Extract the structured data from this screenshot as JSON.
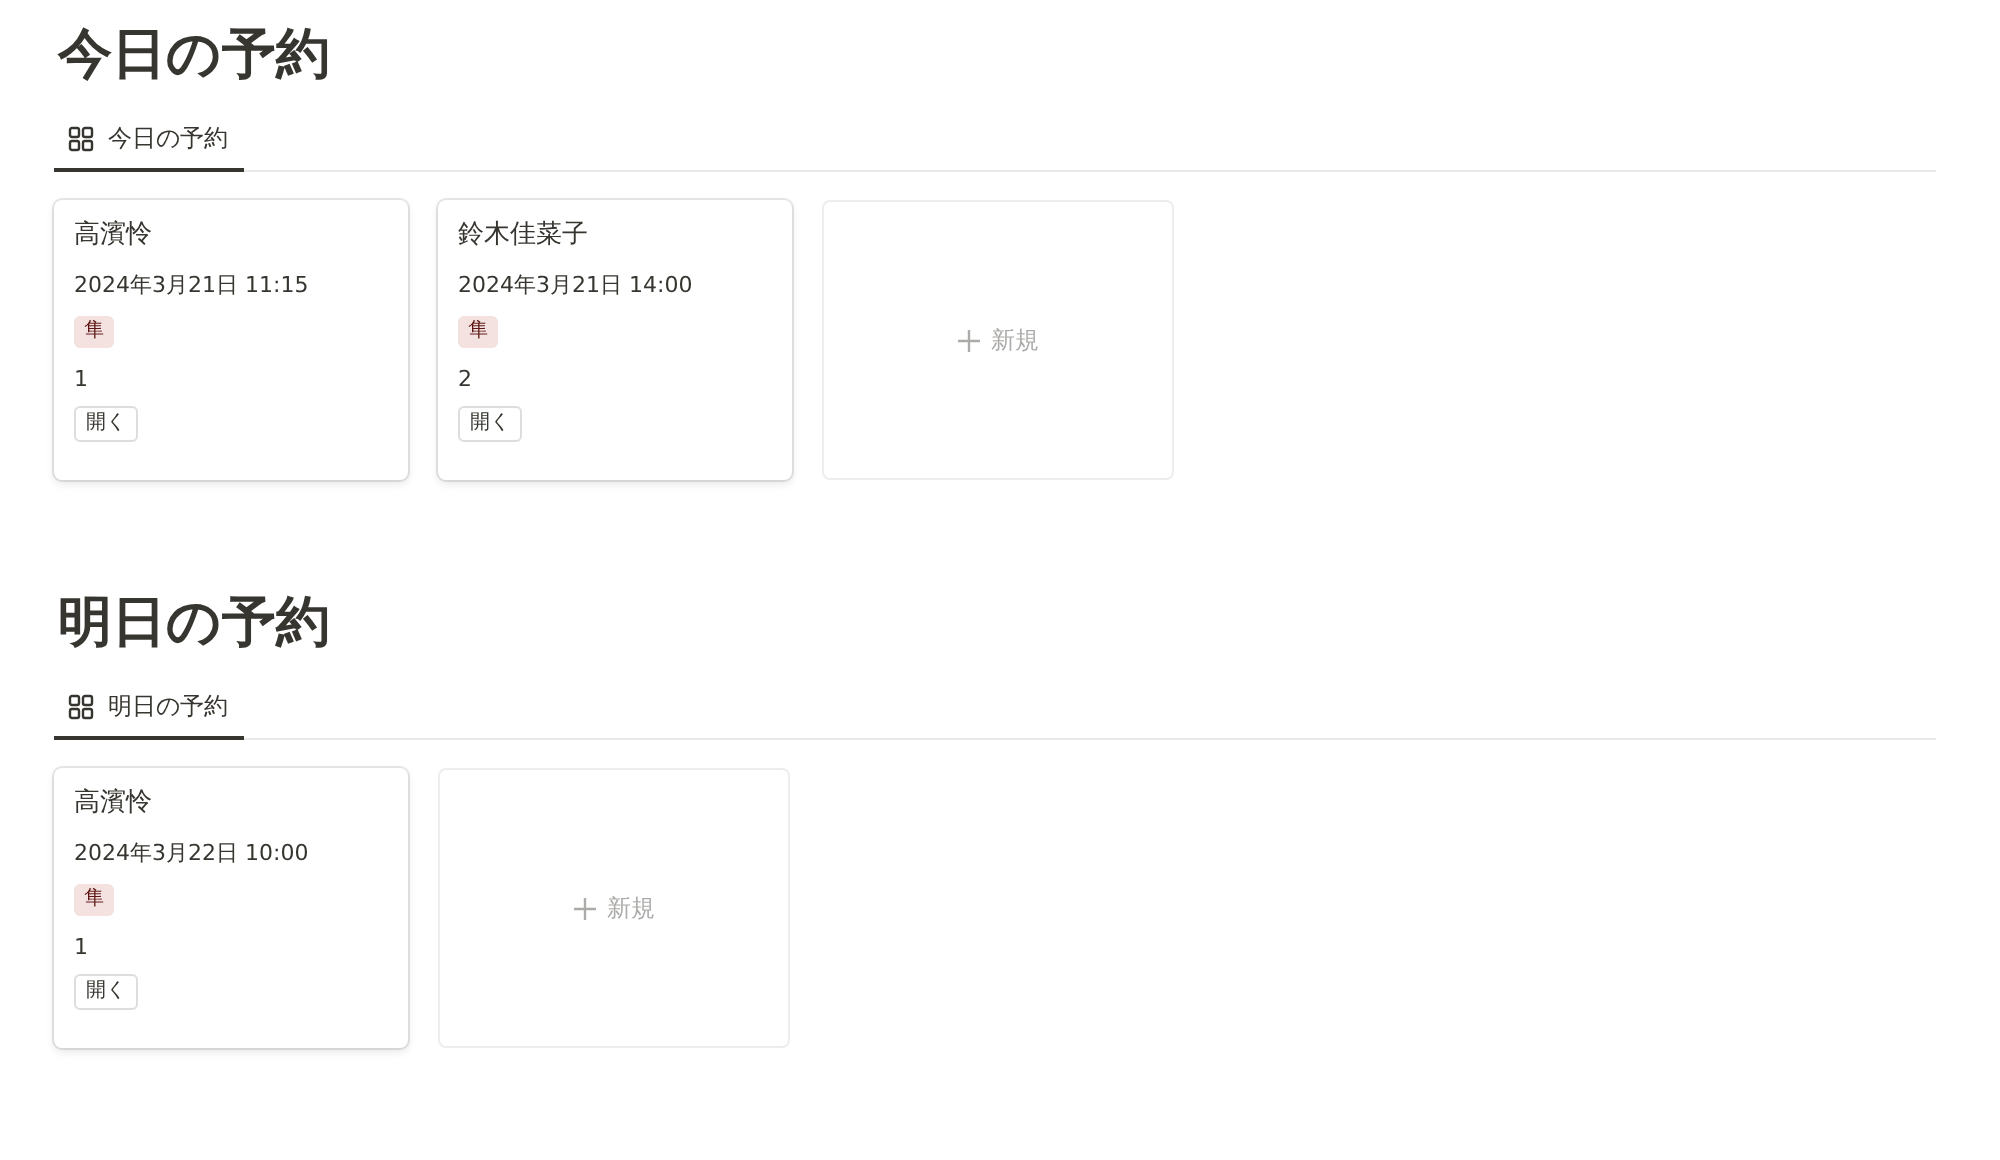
{
  "sections": [
    {
      "title": "今日の予約",
      "tabs": [
        {
          "label": "今日の予約",
          "selected": true
        }
      ],
      "cards": [
        {
          "name": "高濱怜",
          "datetime": "2024年3月21日 11:15",
          "tag": {
            "label": "隼",
            "color": "#f3e2df"
          },
          "count": "1",
          "button": "開く"
        },
        {
          "name": "鈴木佳菜子",
          "datetime": "2024年3月21日 14:00",
          "tag": {
            "label": "隼",
            "color": "#f3e2df"
          },
          "count": "2",
          "button": "開く"
        }
      ],
      "new_label": "新規"
    },
    {
      "title": "明日の予約",
      "tabs": [
        {
          "label": "明日の予約",
          "selected": true
        }
      ],
      "cards": [
        {
          "name": "高濱怜",
          "datetime": "2024年3月22日 10:00",
          "tag": {
            "label": "隼",
            "color": "#f3e2df"
          },
          "count": "1",
          "button": "開く"
        }
      ],
      "new_label": "新規"
    }
  ]
}
